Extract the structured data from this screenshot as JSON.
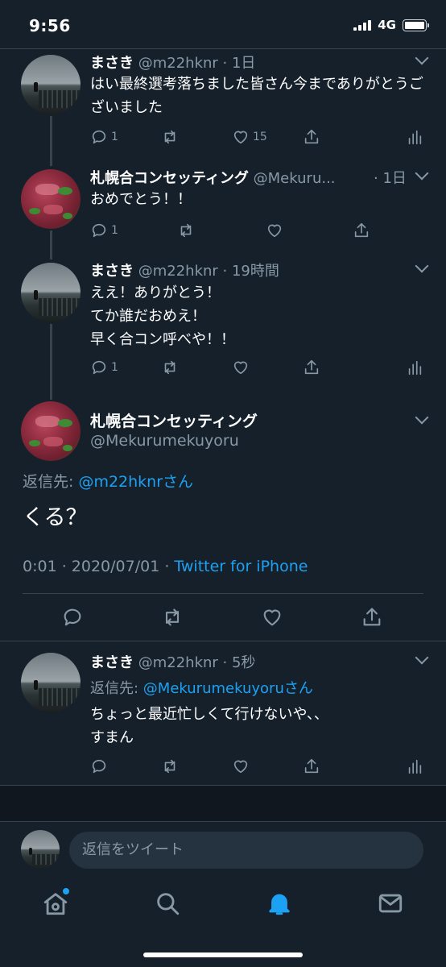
{
  "status": {
    "time": "9:56",
    "network": "4G"
  },
  "thread": [
    {
      "name": "まさき",
      "meta": "@m22hknr · 1日",
      "body": "はい最終選考落ちました皆さん今までありがとうございました",
      "reply_count": "1",
      "like_count": "15"
    },
    {
      "name": "札幌合コンセッティング",
      "meta": "@Mekuru...",
      "time": "· 1日",
      "body": "おめでとう！！",
      "reply_count": "1"
    },
    {
      "name": "まさき",
      "meta": "@m22hknr · 19時間",
      "body_lines": [
        "ええ！ありがとう！",
        "てか誰だおめえ！",
        "早く合コン呼べや！！"
      ],
      "reply_count": "1"
    }
  ],
  "main_tweet": {
    "name": "札幌合コンセッティング",
    "handle": "@Mekurumekuyoru",
    "reply_prefix": "返信先: ",
    "reply_target": "@m22hknrさん",
    "text": "くる？",
    "timestamp": "0:01 · 2020/07/01 · ",
    "source": "Twitter for iPhone"
  },
  "reply": {
    "name": "まさき",
    "meta": "@m22hknr · 5秒",
    "reply_prefix": "返信先: ",
    "reply_target": "@Mekurumekuyoruさん",
    "body_lines": [
      "ちょっと最近忙しくて行けないや、、",
      "すまん"
    ]
  },
  "compose": {
    "placeholder": "返信をツイート"
  },
  "tabs": [
    "home-icon",
    "search-icon",
    "notifications-icon",
    "messages-icon"
  ],
  "colors": {
    "background": "#15202b",
    "accent": "#1da1f2",
    "muted": "#8899a6",
    "divider": "#38444d"
  }
}
